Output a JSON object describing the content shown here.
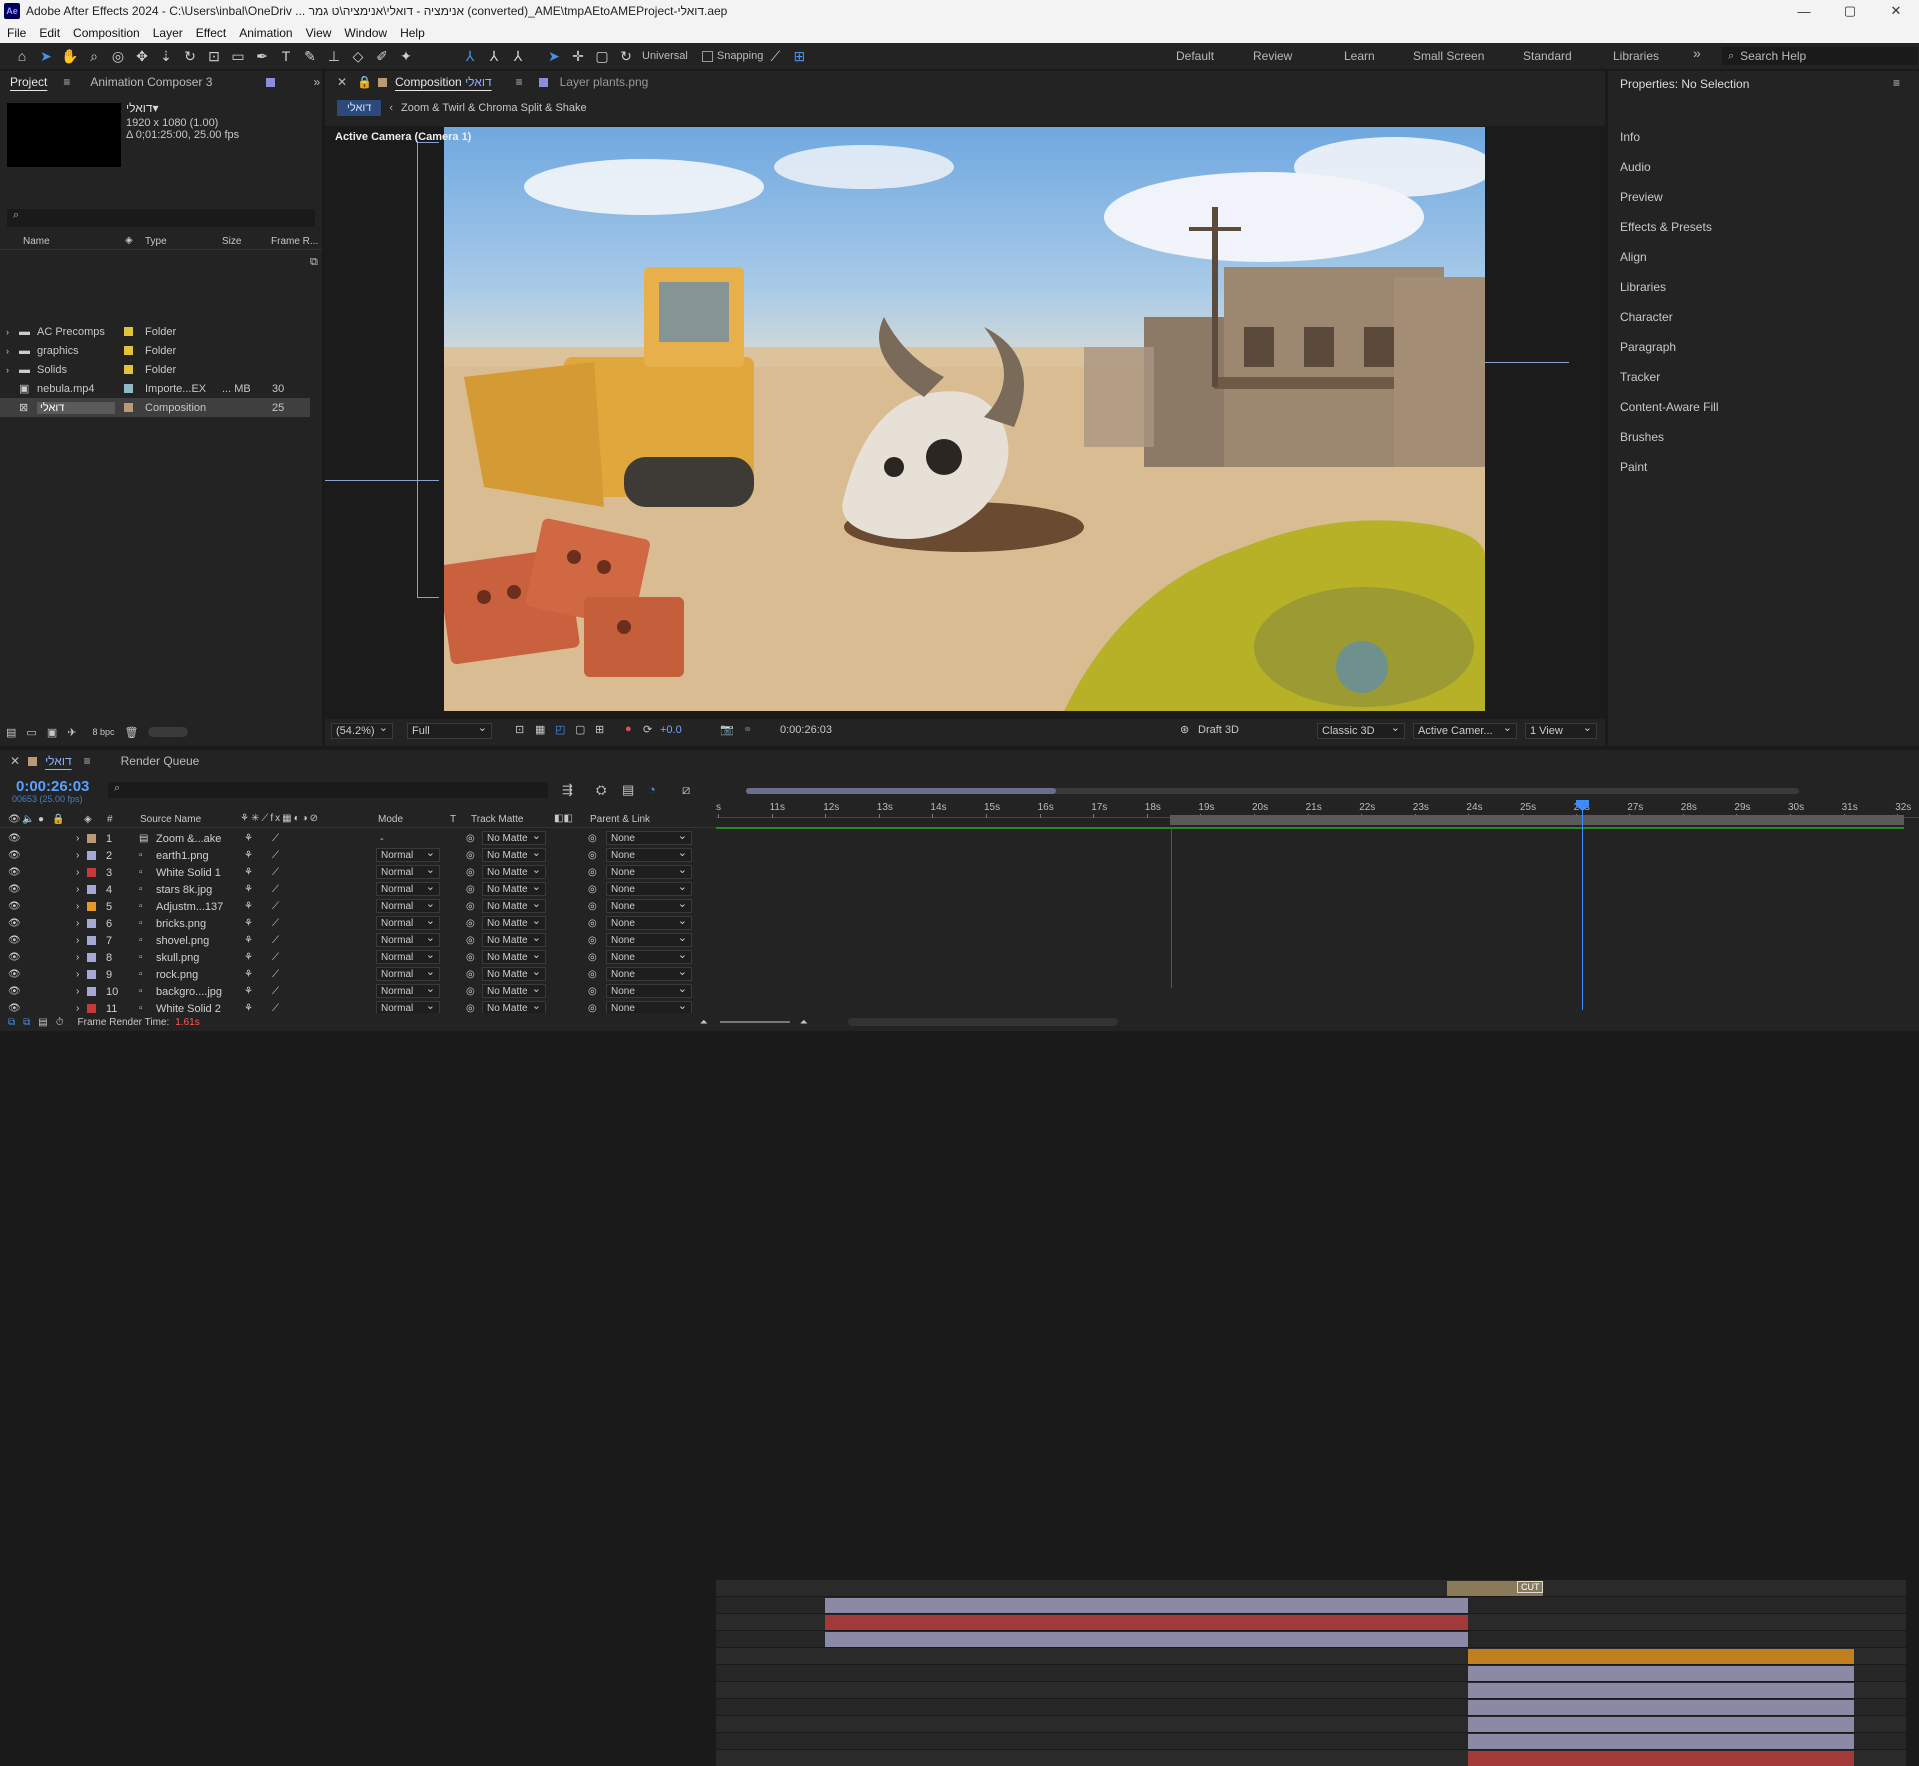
{
  "titlebar": {
    "app_icon": "Ae",
    "title": "Adobe After Effects 2024 - C:\\Users\\inbal\\OneDriv ... אנימציה - דואלי\\אנימציה\\ט גמר (converted)_AME\\tmpAEtoAMEProject-דואלי.aep",
    "minimize": "—",
    "maximize": "▢",
    "close": "✕"
  },
  "menu": [
    "File",
    "Edit",
    "Composition",
    "Layer",
    "Effect",
    "Animation",
    "View",
    "Window",
    "Help"
  ],
  "toolbar": {
    "universal_label": "Universal",
    "snapping_label": "Snapping"
  },
  "workspaces": [
    "Default",
    "Review",
    "Learn",
    "Small Screen",
    "Standard",
    "Libraries"
  ],
  "search_help": "Search Help",
  "project": {
    "tab_label": "Project",
    "tab2_label": "Animation Composer 3",
    "comp_name": "דואלי▾",
    "comp_info_1": "1920 x 1080 (1.00)",
    "comp_info_2": "Δ 0;01:25:00, 25.00 fps",
    "columns": {
      "name": "Name",
      "type": "Type",
      "size": "Size",
      "frame_rate": "Frame R..."
    },
    "items": [
      {
        "name": "AC Precomps",
        "type": "Folder",
        "size": "",
        "fps": "",
        "color": "#e1c33a"
      },
      {
        "name": "graphics",
        "type": "Folder",
        "size": "",
        "fps": "",
        "color": "#e1c33a"
      },
      {
        "name": "Solids",
        "type": "Folder",
        "size": "",
        "fps": "",
        "color": "#e1c33a"
      },
      {
        "name": "nebula.mp4",
        "type": "Importe...EX",
        "size": "... MB",
        "fps": "30",
        "color": "#8fb8c8"
      },
      {
        "name": "דואלי",
        "type": "Composition",
        "size": "",
        "fps": "25",
        "color": "#b99a72"
      }
    ],
    "bpc": "8 bpc"
  },
  "comp_panel": {
    "tab_label": "Composition",
    "tab_comp_name": "דואלי",
    "layer_tab": "Layer  plants.png",
    "breadcrumb_active": "דואלי",
    "breadcrumb_next": "Zoom & Twirl & Chroma Split & Shake",
    "camera_label": "Active Camera (Camera 1)",
    "zoom": "(54.2%)",
    "resolution": "Full",
    "exposure": "+0.0",
    "timecode": "0:00:26:03",
    "renderer_label": "Draft 3D",
    "renderer": "Classic 3D",
    "view": "Active Camer...",
    "views": "1 View"
  },
  "properties": {
    "title": "Properties: No Selection",
    "items": [
      "Info",
      "Audio",
      "Preview",
      "Effects & Presets",
      "Align",
      "Libraries",
      "Character",
      "Paragraph",
      "Tracker",
      "Content-Aware Fill",
      "Brushes",
      "Paint"
    ]
  },
  "timeline": {
    "tab_label": "דואלי",
    "render_queue": "Render Queue",
    "timecode": "0:00:26:03",
    "timecode_sub": "00653 (25.00 fps)",
    "columns": {
      "source_name": "Source Name",
      "mode": "Mode",
      "t": "T",
      "track_matte": "Track Matte",
      "parent": "Parent & Link"
    },
    "ruler": [
      "s",
      "11s",
      "12s",
      "13s",
      "14s",
      "15s",
      "16s",
      "17s",
      "18s",
      "19s",
      "20s",
      "21s",
      "22s",
      "23s",
      "24s",
      "25s",
      "26s",
      "27s",
      "28s",
      "29s",
      "30s",
      "31s",
      "32s"
    ],
    "cut_label": "CUT",
    "layers": [
      {
        "num": "1",
        "name": "Zoom &...ake",
        "mode": "-",
        "matte": "No Matte",
        "parent": "None",
        "color": "#b99a72"
      },
      {
        "num": "2",
        "name": "earth1.png",
        "mode": "Normal",
        "matte": "No Matte",
        "parent": "None",
        "color": "#a6a6d8"
      },
      {
        "num": "3",
        "name": "White Solid 1",
        "mode": "Normal",
        "matte": "No Matte",
        "parent": "None",
        "color": "#c83a3a"
      },
      {
        "num": "4",
        "name": "stars 8k.jpg",
        "mode": "Normal",
        "matte": "No Matte",
        "parent": "None",
        "color": "#a6a6d8"
      },
      {
        "num": "5",
        "name": "Adjustm...137",
        "mode": "Normal",
        "matte": "No Matte",
        "parent": "None",
        "color": "#e49a2a"
      },
      {
        "num": "6",
        "name": "bricks.png",
        "mode": "Normal",
        "matte": "No Matte",
        "parent": "None",
        "color": "#a6a6d8"
      },
      {
        "num": "7",
        "name": "shovel.png",
        "mode": "Normal",
        "matte": "No Matte",
        "parent": "None",
        "color": "#a6a6d8"
      },
      {
        "num": "8",
        "name": "skull.png",
        "mode": "Normal",
        "matte": "No Matte",
        "parent": "None",
        "color": "#a6a6d8"
      },
      {
        "num": "9",
        "name": "rock.png",
        "mode": "Normal",
        "matte": "No Matte",
        "parent": "None",
        "color": "#a6a6d8"
      },
      {
        "num": "10",
        "name": "backgro....jpg",
        "mode": "Normal",
        "matte": "No Matte",
        "parent": "None",
        "color": "#a6a6d8"
      },
      {
        "num": "11",
        "name": "White Solid 2",
        "mode": "Normal",
        "matte": "No Matte",
        "parent": "None",
        "color": "#c83a3a"
      }
    ],
    "frame_render_label": "Frame Render Time:",
    "frame_render_value": "1.61s"
  }
}
